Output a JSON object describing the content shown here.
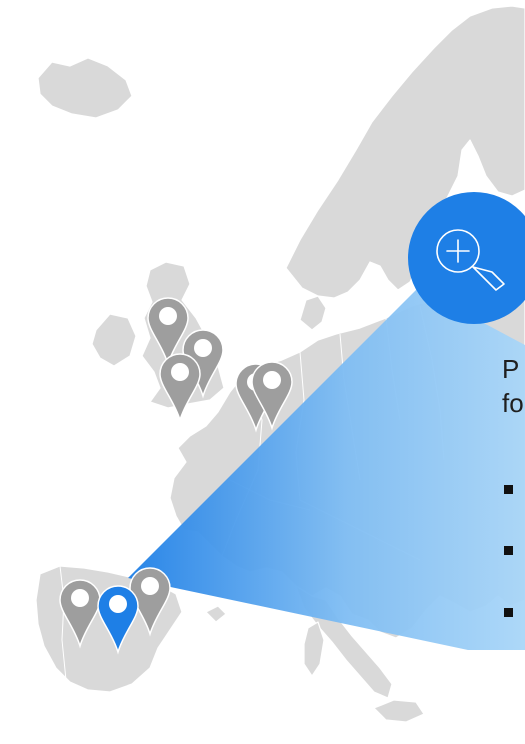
{
  "map": {
    "land_color": "#d9d9d9",
    "pin_inactive_color": "#9e9e9e",
    "pin_active_color": "#1e7fe6",
    "pins": [
      {
        "name": "pin-scotland",
        "active": false
      },
      {
        "name": "pin-north-england",
        "active": false
      },
      {
        "name": "pin-england-midlands",
        "active": false
      },
      {
        "name": "pin-netherlands-1",
        "active": false
      },
      {
        "name": "pin-netherlands-2",
        "active": false
      },
      {
        "name": "pin-portugal",
        "active": false
      },
      {
        "name": "pin-madrid",
        "active": true
      },
      {
        "name": "pin-spain-east",
        "active": false
      }
    ]
  },
  "zoom": {
    "icon": "zoom-in-icon",
    "circle_color": "#1e7fe6",
    "beam_gradient": [
      "#1e7fe6",
      "#a9d6f8"
    ]
  },
  "panel": {
    "lines": [
      "P",
      "fo"
    ],
    "bullet_count": 3
  }
}
